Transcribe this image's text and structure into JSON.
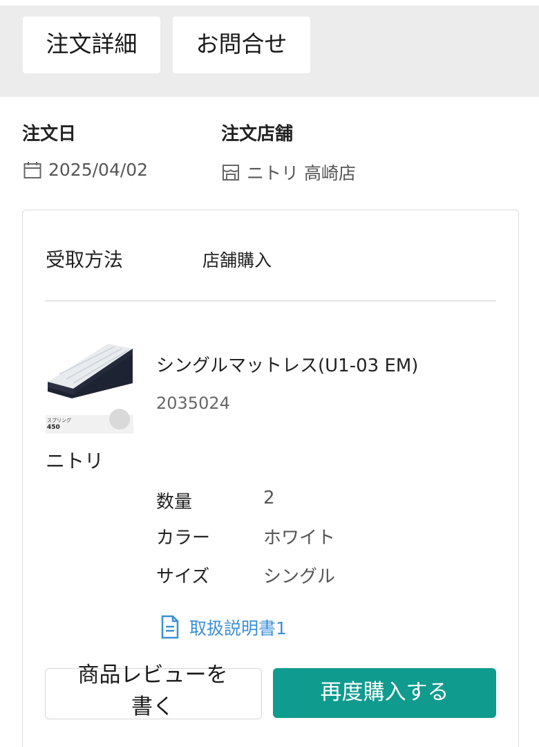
{
  "tabs": {
    "detail_label": "注文詳細",
    "inquiry_label": "お問合せ"
  },
  "order": {
    "date_label": "注文日",
    "date_value": "2025/04/02",
    "store_label": "注文店舗",
    "store_value": "ニトリ 高崎店"
  },
  "receive": {
    "label": "受取方法",
    "value": "店舗購入"
  },
  "product": {
    "brand": "ニトリ",
    "name": "シングルマットレス(U1-03 EM)",
    "code": "2035024",
    "image_caption_line1": "スプリング",
    "image_caption_line2": "450"
  },
  "specs": [
    {
      "label": "数量",
      "value": "2"
    },
    {
      "label": "カラー",
      "value": "ホワイト"
    },
    {
      "label": "サイズ",
      "value": "シングル"
    }
  ],
  "manual": {
    "label": "取扱説明書1"
  },
  "buttons": {
    "review_label_line1": "商品レビューを",
    "review_label_line2": "書く",
    "rebuy_label": "再度購入する"
  },
  "colors": {
    "accent": "#0f9b8e",
    "link": "#3b8fd6",
    "band": "#ececec"
  },
  "icons": [
    "calendar-icon",
    "store-icon",
    "document-icon"
  ]
}
